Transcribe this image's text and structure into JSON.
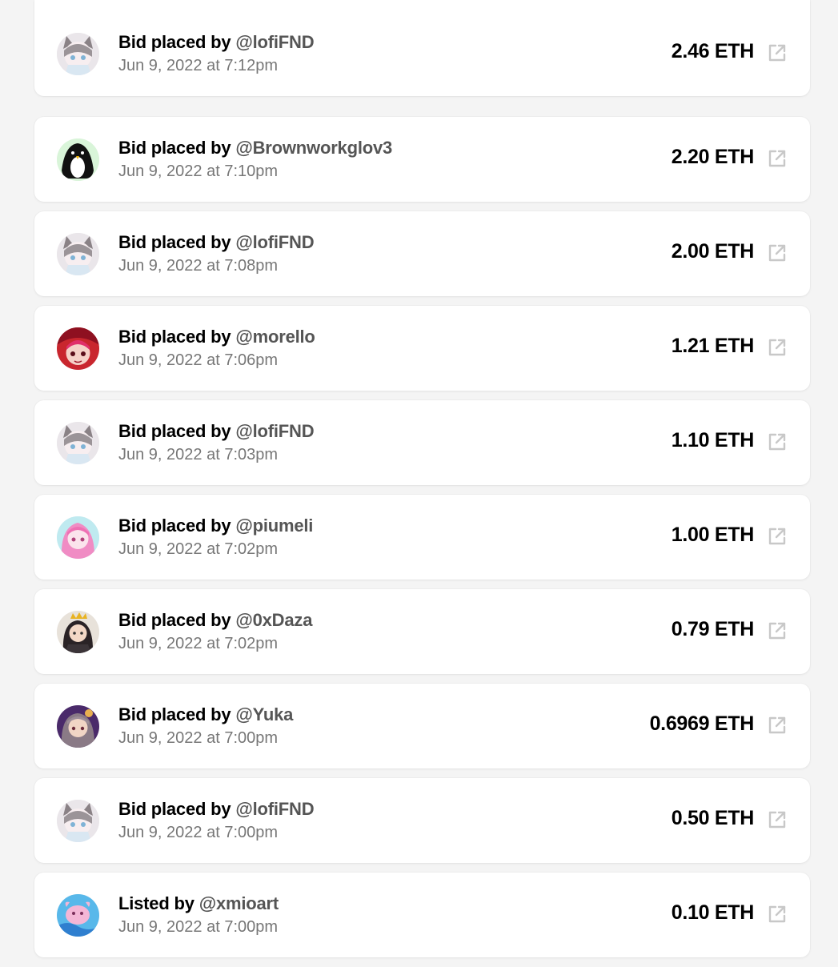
{
  "activity": [
    {
      "action": "Bid placed by",
      "user": "@lofiFND",
      "date": "Jun 9, 2022 at 7:12pm",
      "amount": "2.46 ETH",
      "avatar": "anime-girl-gray"
    },
    {
      "action": "Bid placed by",
      "user": "@Brownworkglov3",
      "date": "Jun 9, 2022 at 7:10pm",
      "amount": "2.20 ETH",
      "avatar": "penguin"
    },
    {
      "action": "Bid placed by",
      "user": "@lofiFND",
      "date": "Jun 9, 2022 at 7:08pm",
      "amount": "2.00 ETH",
      "avatar": "anime-girl-gray"
    },
    {
      "action": "Bid placed by",
      "user": "@morello",
      "date": "Jun 9, 2022 at 7:06pm",
      "amount": "1.21 ETH",
      "avatar": "anime-red"
    },
    {
      "action": "Bid placed by",
      "user": "@lofiFND",
      "date": "Jun 9, 2022 at 7:03pm",
      "amount": "1.10 ETH",
      "avatar": "anime-girl-gray"
    },
    {
      "action": "Bid placed by",
      "user": "@piumeli",
      "date": "Jun 9, 2022 at 7:02pm",
      "amount": "1.00 ETH",
      "avatar": "anime-pink"
    },
    {
      "action": "Bid placed by",
      "user": "@0xDaza",
      "date": "Jun 9, 2022 at 7:02pm",
      "amount": "0.79 ETH",
      "avatar": "character-dark"
    },
    {
      "action": "Bid placed by",
      "user": "@Yuka",
      "date": "Jun 9, 2022 at 7:00pm",
      "amount": "0.6969 ETH",
      "avatar": "anime-purple"
    },
    {
      "action": "Bid placed by",
      "user": "@lofiFND",
      "date": "Jun 9, 2022 at 7:00pm",
      "amount": "0.50 ETH",
      "avatar": "anime-girl-gray"
    },
    {
      "action": "Listed by",
      "user": "@xmioart",
      "date": "Jun 9, 2022 at 7:00pm",
      "amount": "0.10 ETH",
      "avatar": "pink-creature-blue"
    }
  ]
}
